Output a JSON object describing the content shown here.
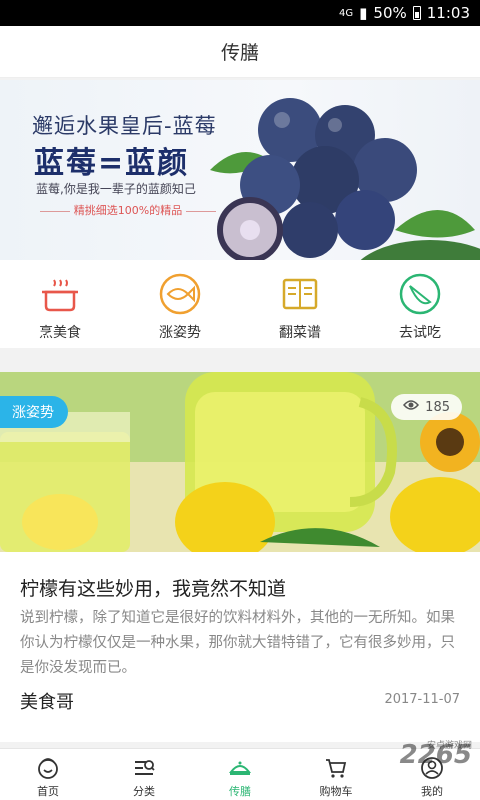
{
  "status_bar": {
    "network": "4G",
    "battery": "50%",
    "time": "11:03"
  },
  "header": {
    "title": "传膳"
  },
  "banner": {
    "line1": "邂逅水果皇后-蓝莓",
    "line2": "蓝莓=蓝颜",
    "line3": "蓝莓,你是我一辈子的蓝颜知己",
    "line4": "精挑细选100%的精品"
  },
  "menu": [
    {
      "label": "烹美食",
      "icon": "pot-icon",
      "color": "#e8574a"
    },
    {
      "label": "涨姿势",
      "icon": "fish-icon",
      "color": "#f0a030"
    },
    {
      "label": "翻菜谱",
      "icon": "book-icon",
      "color": "#d6a92a"
    },
    {
      "label": "去试吃",
      "icon": "watermelon-icon",
      "color": "#2bb673"
    }
  ],
  "card": {
    "tag": "涨姿势",
    "views": "185",
    "title": "柠檬有这些妙用，我竟然不知道",
    "description": "说到柠檬，除了知道它是很好的饮料材料外，其他的一无所知。如果你认为柠檬仅仅是一种水果，那你就大错特错了，它有很多妙用，只是你没发现而已。",
    "author": "美食哥",
    "date": "2017-11-07"
  },
  "tabs": [
    {
      "label": "首页",
      "icon": "home-icon",
      "active": false
    },
    {
      "label": "分类",
      "icon": "category-icon",
      "active": false
    },
    {
      "label": "传膳",
      "icon": "dish-icon",
      "active": true
    },
    {
      "label": "购物车",
      "icon": "cart-icon",
      "active": false
    },
    {
      "label": "我的",
      "icon": "profile-icon",
      "active": false
    }
  ],
  "watermark": {
    "text": "2265",
    "subtext": "安卓游戏网"
  },
  "colors": {
    "accent": "#2bb673",
    "tag": "#2bb4e8"
  }
}
